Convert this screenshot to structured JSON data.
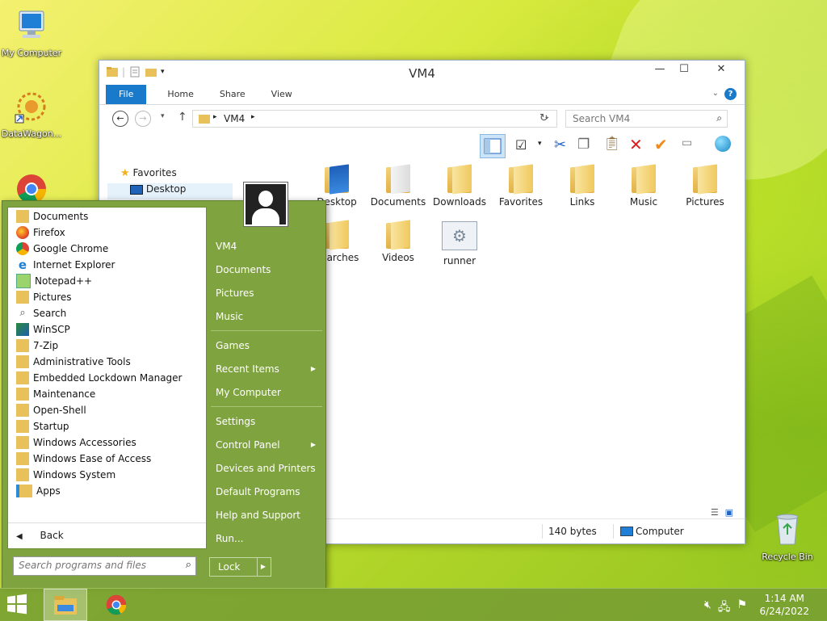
{
  "desktop": {
    "icons": [
      {
        "label": "My Computer"
      },
      {
        "label": "DataWagon..."
      },
      {
        "label": "Recycle Bin"
      }
    ]
  },
  "explorer": {
    "title": "VM4",
    "tabs": {
      "file": "File",
      "home": "Home",
      "share": "Share",
      "view": "View"
    },
    "address": {
      "crumb": "VM4"
    },
    "search_placeholder": "Search VM4",
    "sidebar": {
      "favorites": "Favorites",
      "desktop": "Desktop"
    },
    "items": [
      {
        "label": "Desktop"
      },
      {
        "label": "Documents"
      },
      {
        "label": "Downloads"
      },
      {
        "label": "Favorites"
      },
      {
        "label": "Links"
      },
      {
        "label": "Music"
      },
      {
        "label": "Pictures"
      },
      {
        "label": "Searches"
      },
      {
        "label": "Videos"
      },
      {
        "label": "runner"
      }
    ],
    "status": {
      "size": "140 bytes",
      "location": "Computer"
    }
  },
  "start_menu": {
    "programs": [
      {
        "label": "Documents",
        "icon": "folder-docs-icon"
      },
      {
        "label": "Firefox",
        "icon": "firefox-icon"
      },
      {
        "label": "Google Chrome",
        "icon": "chrome-icon"
      },
      {
        "label": "Internet Explorer",
        "icon": "ie-icon"
      },
      {
        "label": "Notepad++",
        "icon": "notepad-icon"
      },
      {
        "label": "Pictures",
        "icon": "folder-pictures-icon"
      },
      {
        "label": "Search",
        "icon": "search-icon"
      },
      {
        "label": "WinSCP",
        "icon": "winscp-icon"
      },
      {
        "label": "7-Zip",
        "icon": "folder-icon"
      },
      {
        "label": "Administrative Tools",
        "icon": "folder-icon"
      },
      {
        "label": "Embedded Lockdown Manager",
        "icon": "folder-icon"
      },
      {
        "label": "Maintenance",
        "icon": "folder-icon"
      },
      {
        "label": "Open-Shell",
        "icon": "folder-icon"
      },
      {
        "label": "Startup",
        "icon": "folder-icon"
      },
      {
        "label": "Windows Accessories",
        "icon": "folder-icon"
      },
      {
        "label": "Windows Ease of Access",
        "icon": "folder-icon"
      },
      {
        "label": "Windows System",
        "icon": "folder-icon"
      },
      {
        "label": "Apps",
        "icon": "apps-icon"
      }
    ],
    "back": "Back",
    "search_placeholder": "Search programs and files",
    "right": [
      {
        "label": "VM4"
      },
      {
        "label": "Documents"
      },
      {
        "label": "Pictures"
      },
      {
        "label": "Music"
      },
      {
        "label": "Games"
      },
      {
        "label": "Recent Items"
      },
      {
        "label": "My Computer"
      },
      {
        "label": "Settings"
      },
      {
        "label": "Control Panel"
      },
      {
        "label": "Devices and Printers"
      },
      {
        "label": "Default Programs"
      },
      {
        "label": "Help and Support"
      },
      {
        "label": "Run..."
      }
    ],
    "lock": "Lock"
  },
  "taskbar": {
    "time": "1:14 AM",
    "date": "6/24/2022"
  }
}
